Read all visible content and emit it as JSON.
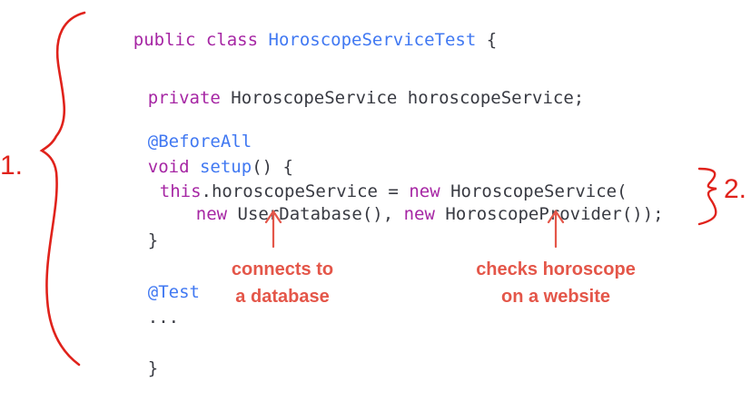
{
  "code": {
    "l1": {
      "kw": "public class",
      "name": "HoroscopeServiceTest",
      "tail": " {"
    },
    "l2": {
      "kw": "private",
      "type": "HoroscopeService",
      "var": " horoscopeService;"
    },
    "l3": {
      "annotation": "@BeforeAll"
    },
    "l4": {
      "kw": "void",
      "fn": "setup",
      "tail": "() {"
    },
    "l5": {
      "kw": "this",
      "mid": ".horoscopeService = ",
      "new": "new",
      "type": "HoroscopeService",
      "tail": "("
    },
    "l6": {
      "new1": "new",
      "type1": "UserDatabase",
      "mid": "(), ",
      "new2": "new",
      "type2": "HoroscopeProvider",
      "tail": "());"
    },
    "l7": {
      "text": "}"
    },
    "l8": {
      "annotation": "@Test"
    },
    "l9": {
      "text": "..."
    },
    "l10": {
      "text": "}"
    }
  },
  "annotations": {
    "note1": [
      "connects to",
      "a database"
    ],
    "note2": [
      "checks horoscope",
      "on a website"
    ],
    "marker1": "1.",
    "marker2": "2."
  },
  "colors": {
    "red": "#e45649",
    "keyword": "#a626a4",
    "type": "#4078f2"
  }
}
